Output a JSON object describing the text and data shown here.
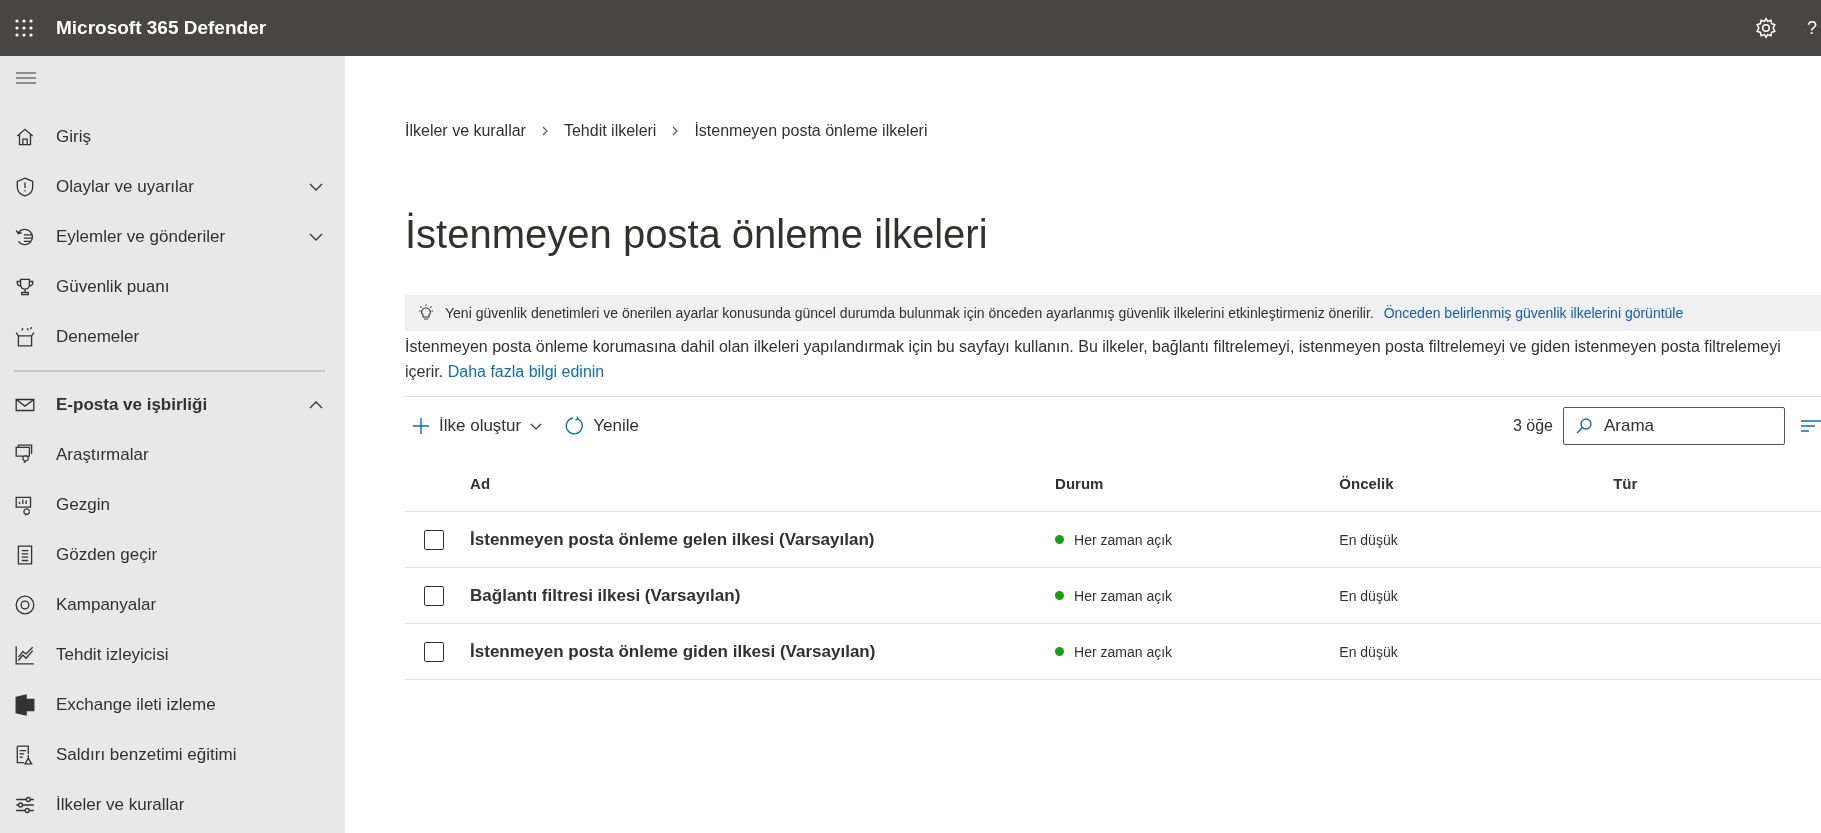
{
  "header": {
    "title": "Microsoft 365 Defender",
    "help": "?"
  },
  "sidebar": {
    "items": [
      {
        "kind": "item",
        "label": "Giriş"
      },
      {
        "kind": "item",
        "label": "Olaylar ve uyarılar",
        "expanded": false
      },
      {
        "kind": "item",
        "label": "Eylemler ve gönderiler",
        "expanded": false
      },
      {
        "kind": "item",
        "label": "Güvenlik puanı"
      },
      {
        "kind": "item",
        "label": "Denemeler"
      },
      {
        "kind": "divider"
      },
      {
        "kind": "section",
        "label": "E-posta ve işbirliği",
        "expanded": true
      },
      {
        "kind": "item",
        "label": "Araştırmalar"
      },
      {
        "kind": "item",
        "label": "Gezgin"
      },
      {
        "kind": "item",
        "label": "Gözden geçir"
      },
      {
        "kind": "item",
        "label": "Kampanyalar"
      },
      {
        "kind": "item",
        "label": "Tehdit izleyicisi"
      },
      {
        "kind": "item",
        "label": "Exchange ileti izleme"
      },
      {
        "kind": "item",
        "label": "Saldırı benzetimi eğitimi"
      },
      {
        "kind": "item",
        "label": "İlkeler ve kurallar"
      }
    ]
  },
  "breadcrumb": [
    "İlkeler ve kurallar",
    "Tehdit ilkeleri",
    "İstenmeyen posta önleme ilkeleri"
  ],
  "page_title": "İstenmeyen posta önleme ilkeleri",
  "info_bar": {
    "text": "Yeni güvenlik denetimleri ve önerilen ayarlar konusunda güncel durumda bulunmak için önceden ayarlanmış güvenlik ilkelerini etkinleştirmeniz önerilir.",
    "link": "Önceden belirlenmiş güvenlik ilkelerini görüntüle"
  },
  "description": {
    "text": "İstenmeyen posta önleme korumasına dahil olan ilkeleri yapılandırmak için bu sayfayı kullanın. Bu ilkeler, bağlantı filtrelemeyi, istenmeyen posta filtrelemeyi ve giden istenmeyen posta filtrelemeyi içerir.",
    "link": "Daha fazla bilgi edinin"
  },
  "toolbar": {
    "create": "İlke oluştur",
    "refresh": "Yenile",
    "count": "3 öğe",
    "search": {
      "placeholder": "Arama"
    }
  },
  "table": {
    "columns": [
      "Ad",
      "Durum",
      "Öncelik",
      "Tür"
    ],
    "rows": [
      {
        "name": "İstenmeyen posta önleme gelen ilkesi (Varsayılan)",
        "status": "Her zaman açık",
        "priority": "En düşük",
        "checked": false
      },
      {
        "name": "Bağlantı filtresi ilkesi (Varsayılan)",
        "status": "Her zaman açık",
        "priority": "En düşük",
        "checked": false
      },
      {
        "name": "İstenmeyen posta önleme giden ilkesi (Varsayılan)",
        "status": "Her zaman açık",
        "priority": "En düşük",
        "checked": false
      }
    ]
  }
}
